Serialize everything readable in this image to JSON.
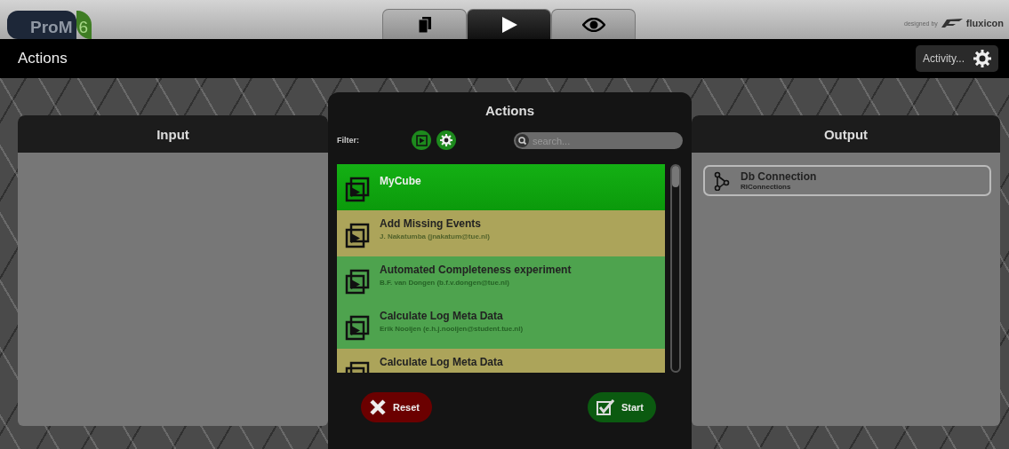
{
  "logo": {
    "name": "ProM",
    "version": "6"
  },
  "view_tabs": [
    {
      "kind": "pages",
      "selected": false
    },
    {
      "kind": "play",
      "selected": true
    },
    {
      "kind": "eye",
      "selected": false
    }
  ],
  "credit": {
    "prefix": "designed by",
    "brand": "fluxicon"
  },
  "title_bar": {
    "title": "Actions",
    "activity_button": "Activity..."
  },
  "input_panel": {
    "title": "Input"
  },
  "output_panel": {
    "title": "Output",
    "items": [
      {
        "name": "Db Connection",
        "type": "RIConnections"
      }
    ]
  },
  "actions_dialog": {
    "title": "Actions",
    "filter_label": "Filter:",
    "filters": [
      {
        "kind": "play",
        "on": true
      },
      {
        "kind": "gear",
        "on": true
      }
    ],
    "search": {
      "placeholder": "search..."
    },
    "actions": [
      {
        "name": "MyCube",
        "selected": true,
        "color": "#0b9a0b"
      },
      {
        "name": "Add Missing Events",
        "author": "J. Nakatumba (jnakatum@tue.nl)",
        "selected": false,
        "color": "#aca45a"
      },
      {
        "name": "Automated Completeness experiment",
        "author": "B.F. van Dongen (b.f.v.dongen@tue.nl)",
        "selected": false,
        "color": "#4ea34e"
      },
      {
        "name": "Calculate Log Meta Data",
        "author": "Erik Nooijen (e.h.j.nooijen@student.tue.nl)",
        "selected": false,
        "color": "#4ea34e"
      },
      {
        "name": "Calculate Log Meta Data",
        "selected": false,
        "color": "#aca45a"
      }
    ],
    "reset_button": "Reset",
    "start_button": "Start"
  }
}
